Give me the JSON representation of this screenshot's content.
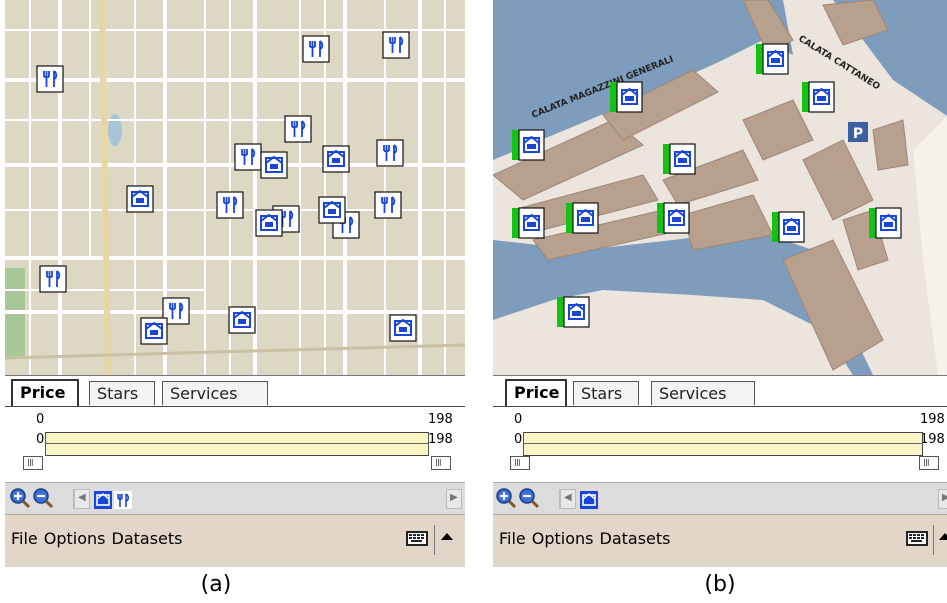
{
  "panels": [
    {
      "caption": "(a)",
      "tabs": [
        "Price",
        "Stars",
        "Services"
      ],
      "active_tab": "Price",
      "range": {
        "min_label": "0",
        "max_label": "198",
        "low_value": "0",
        "high_value": "198"
      },
      "toolbar": {
        "icons": [
          "zoom-in-icon",
          "zoom-out-icon",
          "hotel-layer-icon",
          "restaurant-layer-icon"
        ]
      },
      "menu": [
        "File",
        "Options",
        "Datasets"
      ],
      "map": {
        "kind": "street-map",
        "markers": [
          "hotel",
          "restaurant"
        ],
        "text_note": "street labels too small to read"
      }
    },
    {
      "caption": "(b)",
      "tabs": [
        "Price",
        "Stars",
        "Services"
      ],
      "active_tab": "Price",
      "range": {
        "min_label": "0",
        "max_label": "198",
        "low_value": "0",
        "high_value": "198"
      },
      "toolbar": {
        "icons": [
          "zoom-in-icon",
          "zoom-out-icon",
          "hotel-layer-icon"
        ]
      },
      "menu": [
        "File",
        "Options",
        "Datasets"
      ],
      "map": {
        "kind": "harbor-map",
        "labels": [
          "CALATA MAGAZZINI GENERALI",
          "CALATA CATTANEO",
          "P"
        ],
        "markers": [
          "hotel"
        ]
      }
    }
  ],
  "colors": {
    "map_a_bg": "#ddd8c4",
    "map_b_water": "#7e9dbd",
    "map_b_land": "#ece5dd",
    "map_b_building": "#b8a08e",
    "marker_blue": "#1a46d8",
    "price_bar_green": "#13c213",
    "range_fill": "#fbf5c6",
    "menubar": "#e1d6c8"
  }
}
